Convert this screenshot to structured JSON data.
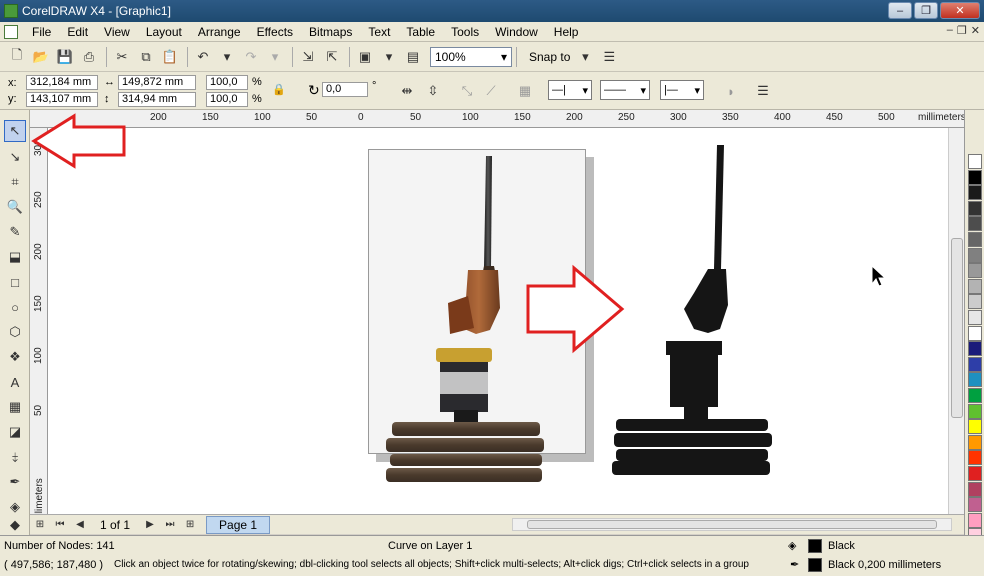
{
  "window": {
    "title": "CorelDRAW X4 - [Graphic1]",
    "minimize": "–",
    "restore": "❐",
    "close": "✕"
  },
  "menu": [
    "File",
    "Edit",
    "View",
    "Layout",
    "Arrange",
    "Effects",
    "Bitmaps",
    "Text",
    "Table",
    "Tools",
    "Window",
    "Help"
  ],
  "toolbar": {
    "zoom": "100%",
    "snap_to": "Snap to"
  },
  "property_bar": {
    "x_label": "x:",
    "x_value": "312,184 mm",
    "y_label": "y:",
    "y_value": "143,107 mm",
    "width_value": "149,872 mm",
    "height_value": "314,94 mm",
    "scale_x": "100,0",
    "scale_y": "100,0",
    "percent": "%",
    "rotation": "0,0",
    "degree": "°"
  },
  "ruler": {
    "h_ticks": [
      "200",
      "150",
      "100",
      "50",
      "0",
      "50",
      "100",
      "150",
      "200",
      "250",
      "300",
      "350",
      "400",
      "450",
      "500"
    ],
    "units": "millimeters",
    "v_ticks": [
      "300",
      "250",
      "200",
      "150",
      "100",
      "50"
    ],
    "v_units": "millimeters"
  },
  "page_nav": {
    "counter": "1 of 1",
    "tab": "Page 1"
  },
  "status": {
    "nodes": "Number of Nodes: 141",
    "object": "Curve on Layer 1",
    "coords": "( 497,586; 187,480 )",
    "hint": "Click an object twice for rotating/skewing; dbl-clicking tool selects all objects; Shift+click multi-selects; Alt+click digs; Ctrl+click selects in a group",
    "fill": "Black",
    "outline": "Black  0,200 millimeters"
  },
  "palette_colors": [
    "#ffffff",
    "#000000",
    "#1a1a1a",
    "#333333",
    "#4d4d4d",
    "#666666",
    "#808080",
    "#999999",
    "#b3b3b3",
    "#cccccc",
    "#e6e6e6",
    "#ffffff",
    "#1b1b7a",
    "#2e3ea8",
    "#1e90c0",
    "#00a040",
    "#60c030",
    "#ffff00",
    "#ff9900",
    "#ff3300",
    "#e02020",
    "#b04060",
    "#c06090",
    "#ff9ec0",
    "#ffd0e0"
  ],
  "colors": {
    "accent": "#316ac5",
    "arrow": "#e02020"
  }
}
